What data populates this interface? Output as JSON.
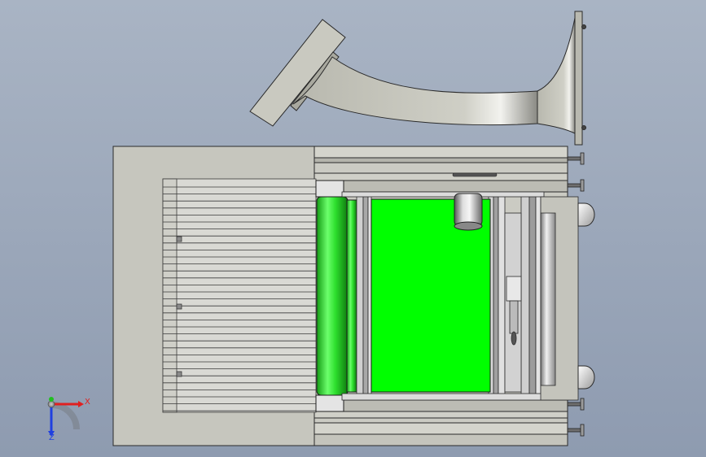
{
  "viewport": {
    "background_top": "#a9b4c4",
    "background_bottom": "#8e9bb0"
  },
  "colors": {
    "frame_fill": "#c8c8c0",
    "frame_stroke": "#2a2a2a",
    "roller_green": "#2ee02e",
    "panel_green": "#00ff00",
    "metal_light": "#e2e2e2",
    "metal_mid": "#bdbdbd",
    "metal_dark": "#6e6e6e"
  },
  "triad": {
    "x_label": "X",
    "z_label": "Z",
    "x_color": "#e02020",
    "y_color": "#20c020",
    "z_color": "#2040e0"
  },
  "icons": {
    "triad": "coordinate-triad-icon"
  }
}
